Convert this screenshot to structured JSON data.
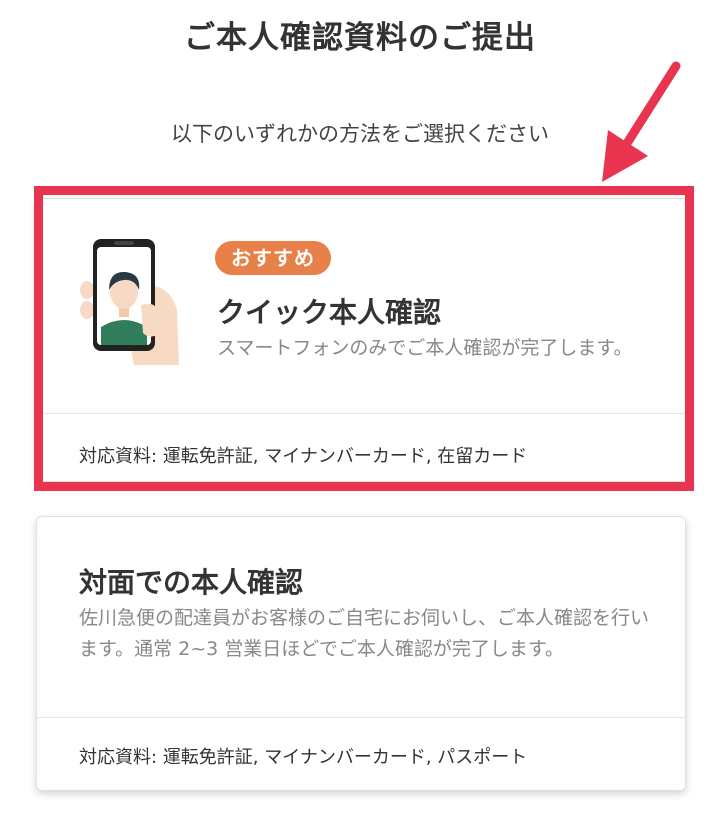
{
  "header": {
    "title": "ご本人確認資料のご提出",
    "subtitle": "以下のいずれかの方法をご選択ください"
  },
  "options": [
    {
      "badge": "おすすめ",
      "title": "クイック本人確認",
      "description": "スマートフォンのみでご本人確認が完了します。",
      "documents": "対応資料: 運転免許証, マイナンバーカード, 在留カード"
    },
    {
      "title": "対面での本人確認",
      "description": "佐川急便の配達員がお客様のご自宅にお伺いし、ご本人確認を行います。通常 2~3 営業日ほどでご本人確認が完了します。",
      "documents": "対応資料: 運転免許証, マイナンバーカード, パスポート"
    }
  ],
  "colors": {
    "highlight": "#e8344e",
    "badge": "#e8804a",
    "title_text": "#333333",
    "description_text": "#888888"
  },
  "icons": {
    "quick_option_illustration": "hand-holding-phone-selfie-icon",
    "annotation": "red-arrow-icon"
  }
}
